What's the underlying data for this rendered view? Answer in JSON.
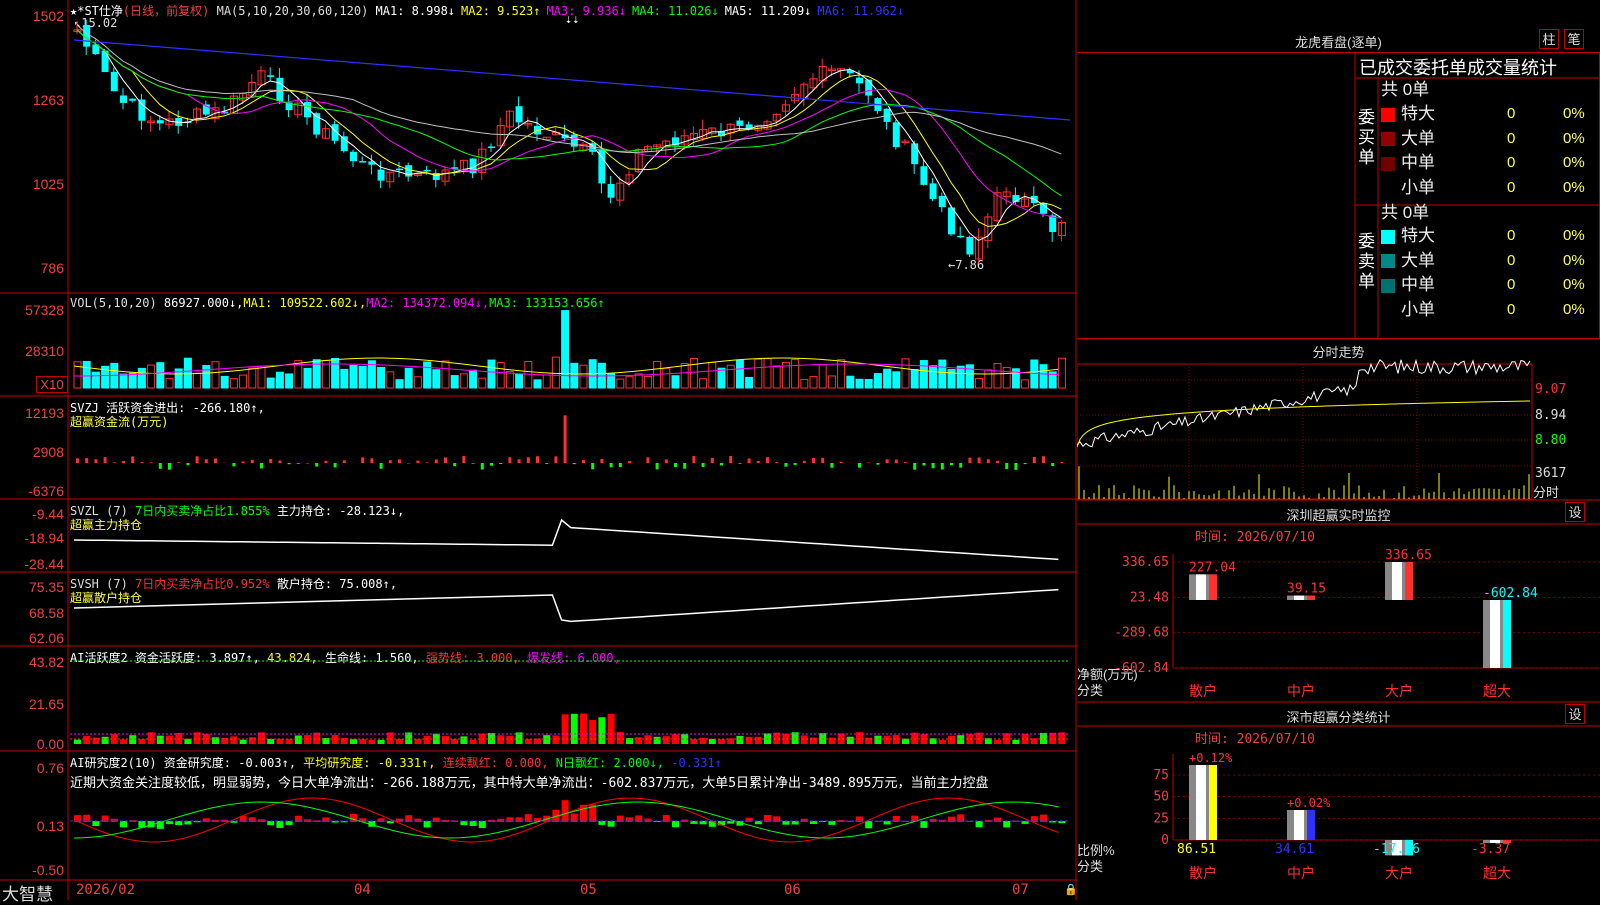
{
  "stock": {
    "name": "★*ST仕净",
    "period": "(日线，前复权)",
    "ma_header": "MA(5,10,20,30,60,120)",
    "ma": [
      {
        "label": "MA1:",
        "value": "8.998↓",
        "color": "#ffffff"
      },
      {
        "label": "MA2:",
        "value": "9.523↑",
        "color": "#ffff00"
      },
      {
        "label": "MA3:",
        "value": "9.936↓",
        "color": "#ff00ff"
      },
      {
        "label": "MA4:",
        "value": "11.026↓",
        "color": "#00ff00"
      },
      {
        "label": "MA5:",
        "value": "11.209↓",
        "color": "#ffffff"
      },
      {
        "label": "MA6:",
        "value": "11.962↓",
        "color": "#3030ff"
      }
    ],
    "high_mark": "15.02",
    "low_mark": "←7.86",
    "top_icon": "⇣⇣"
  },
  "axes": {
    "price": [
      "1502",
      "1263",
      "1025",
      "786"
    ],
    "vol": [
      "57328",
      "28310",
      "X10"
    ],
    "svzj": [
      "12193",
      "2908",
      "-6376"
    ],
    "svzl": [
      "-9.44",
      "-18.94",
      "-28.44"
    ],
    "svsh": [
      "75.35",
      "68.58",
      "62.06"
    ],
    "ai1": [
      "43.82",
      "21.65",
      "0.00"
    ],
    "ai2": [
      "0.76",
      "0.13",
      "-0.50"
    ],
    "dates": [
      "2026/02",
      "04",
      "05",
      "06",
      "07"
    ]
  },
  "indicators": {
    "vol_line": [
      {
        "t": "VOL(5,10,20)",
        "c": "#ddd"
      },
      {
        "t": " 86927.000↓,",
        "c": "#fff"
      },
      {
        "t": "MA1: 109522.602↓,",
        "c": "#ffff00"
      },
      {
        "t": "MA2: 134372.094↓,",
        "c": "#ff00ff"
      },
      {
        "t": "MA3: 133153.656↑",
        "c": "#00ff00"
      }
    ],
    "svzj_line": [
      {
        "t": "SVZJ  活跃资金进出: -266.180↑,",
        "c": "#fff"
      }
    ],
    "svzj_sub": "超赢资金流(万元)",
    "svzl_line": [
      {
        "t": "SVZL (7) ",
        "c": "#ddd"
      },
      {
        "t": "7日内买卖净占比1.855%",
        "c": "#00ff00"
      },
      {
        "t": " 主力持仓: -28.123↓,",
        "c": "#fff"
      }
    ],
    "svzl_sub": "超赢主力持仓",
    "svsh_line": [
      {
        "t": "SVSH (7) ",
        "c": "#ddd"
      },
      {
        "t": "7日内买卖净占比0.952%",
        "c": "#ff3030"
      },
      {
        "t": " 散户持仓: 75.008↑,",
        "c": "#fff"
      }
    ],
    "svsh_sub": "超赢散户持仓",
    "ai1_line": [
      {
        "t": "AI活跃度2 资金活跃度: 3.897↑,",
        "c": "#fff"
      },
      {
        "t": " 43.824,",
        "c": "#ffff00"
      },
      {
        "t": " 生命线: 1.560,",
        "c": "#fff"
      },
      {
        "t": " 强势线: 3.000,",
        "c": "#ff3030"
      },
      {
        "t": " 爆发线: 6.000,",
        "c": "#ff00ff"
      }
    ],
    "ai2_line": [
      {
        "t": "AI研究度2(10) 资金研究度: -0.003↑,",
        "c": "#fff"
      },
      {
        "t": " 平均研究度: -0.331↑,",
        "c": "#ffff00"
      },
      {
        "t": " 连续飘红: 0.000,",
        "c": "#ff3030"
      },
      {
        "t": " N日飘红: 2.000↓,",
        "c": "#00ff00"
      },
      {
        "t": " -0.331↑",
        "c": "#3030ff"
      }
    ],
    "ai2_text": "近期大资金关注度较低，明显弱势，今日大单净流出：-266.188万元，其中特大单净流出：-602.837万元，大单5日累计净出-3489.895万元，当前主力控盘"
  },
  "logo": "大智慧",
  "right": {
    "lhb_title": "龙虎看盘(逐单)",
    "btn_zhu": "柱",
    "btn_bi": "笔",
    "stats_title": "已成交委托单成交量统计",
    "buy_group": "委买单",
    "sell_group": "委卖单",
    "buy_total": "共 0单",
    "sell_total": "共 0单",
    "buy_rows": [
      {
        "label": "特大",
        "color": "#ff0000",
        "v": "0",
        "p": "0%"
      },
      {
        "label": "大单",
        "color": "#900000",
        "v": "0",
        "p": "0%"
      },
      {
        "label": "中单",
        "color": "#700000",
        "v": "0",
        "p": "0%"
      },
      {
        "label": "小单",
        "color": "",
        "v": "0",
        "p": "0%"
      }
    ],
    "sell_rows": [
      {
        "label": "特大",
        "color": "#00ffff",
        "v": "0",
        "p": "0%"
      },
      {
        "label": "大单",
        "color": "#008888",
        "v": "0",
        "p": "0%"
      },
      {
        "label": "中单",
        "color": "#007070",
        "v": "0",
        "p": "0%"
      },
      {
        "label": "小单",
        "color": "",
        "v": "0",
        "p": "0%"
      }
    ],
    "fs_title": "分时走势",
    "fs_axis": [
      "9.07",
      "8.94",
      "8.80",
      "3617",
      "分时"
    ],
    "mon_title": "深圳超赢实时监控",
    "mon_btn": "设",
    "mon_time": "时间: 2026/07/10",
    "mon_axis": [
      "336.65",
      "23.48",
      "-289.68",
      "-602.84"
    ],
    "mon_ylabel": [
      "净额(万元)",
      "分类"
    ],
    "cls_title": "深市超赢分类统计",
    "cls_btn": "设",
    "cls_time": "时间: 2026/07/10",
    "cls_axis": [
      "75",
      "50",
      "25",
      "0"
    ],
    "cls_ylabel": [
      "比例%",
      "分类"
    ]
  },
  "chart_data": [
    {
      "type": "bar",
      "title": "深圳超赢实时监控",
      "categories": [
        "散户",
        "中户",
        "大户",
        "超大"
      ],
      "values": [
        227.04,
        39.15,
        336.65,
        -602.84
      ],
      "ylim": [
        -602.84,
        336.65
      ],
      "colors": [
        "#ff3030",
        "#ff3030",
        "#ff3030",
        "#00ffff"
      ]
    },
    {
      "type": "bar",
      "title": "深市超赢分类统计",
      "categories": [
        "散户",
        "中户",
        "大户",
        "超大"
      ],
      "values": [
        86.51,
        34.61,
        -17.76,
        -3.37
      ],
      "top_labels": [
        "+0.12%",
        "+0.02%",
        "",
        ""
      ],
      "ylim": [
        0,
        90
      ],
      "colors": [
        "#ffff00",
        "#3030ff",
        "#00ffff",
        "#ff3030"
      ]
    }
  ]
}
